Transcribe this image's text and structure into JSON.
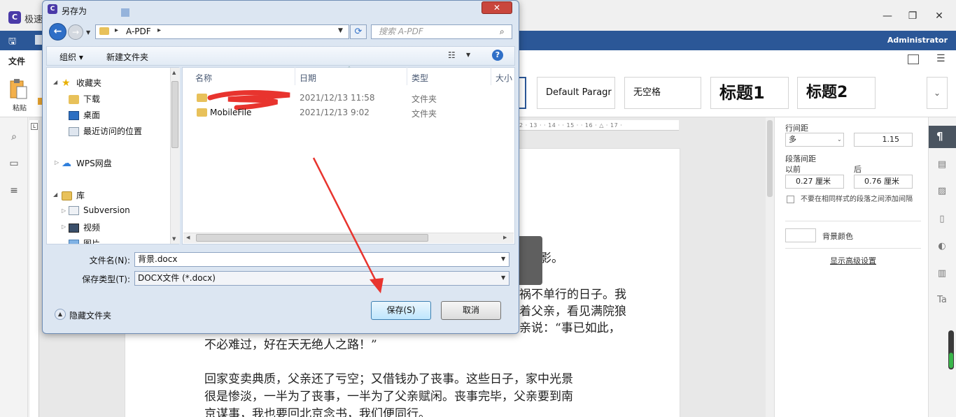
{
  "app": {
    "title": "极速",
    "user": "Administrator",
    "tab_file": "文件",
    "paste": "粘贴"
  },
  "styles": [
    "Default Paragr",
    "无空格",
    "标题1",
    "标题2"
  ],
  "ruler_text": "2 · 13 · · 14 · · 15 · · 16 · △ · 17 ·",
  "document": {
    "lines": [
      "的背影。",
      "祸不单行的日子。我",
      "着父亲，看见满院狼",
      "亲说：“事已如此，",
      "不必难过，好在天无绝人之路！”",
      "回家变卖典质，父亲还了亏空；又借钱办了丧事。这些日子，家中光景",
      "很是惨淡，一半为了丧事，一半为了父亲赋闲。丧事完毕，父亲要到南",
      "京谋事，我也要回北京念书，我们便同行。"
    ]
  },
  "panel": {
    "line_spacing_label": "行间距",
    "line_spacing_mode": "多",
    "line_spacing_value": "1.15",
    "para_spacing_label": "段落间距",
    "before_label": "以前",
    "after_label": "后",
    "before_value": "0.27 厘米",
    "after_value": "0.76 厘米",
    "no_space_checkbox": "不要在相同样式的段落之间添加间隔",
    "bg_color_label": "背景颜色",
    "advanced_link": "显示高级设置"
  },
  "dialog": {
    "title": "另存为",
    "address": "A-PDF",
    "search_placeholder": "搜索 A-PDF",
    "organize": "组织 ▾",
    "new_folder": "新建文件夹",
    "nav": {
      "favorites": "收藏夹",
      "downloads": "下载",
      "desktop": "桌面",
      "recent": "最近访问的位置",
      "wps_cloud": "WPS网盘",
      "libraries": "库",
      "subversion": "Subversion",
      "videos": "视频",
      "pictures": "图片"
    },
    "columns": {
      "name": "名称",
      "date": "日期",
      "type": "类型",
      "size": "大小"
    },
    "files": [
      {
        "name": "",
        "date": "2021/12/13 11:58",
        "type": "文件夹"
      },
      {
        "name": "MobileFile",
        "date": "2021/12/13 9:02",
        "type": "文件夹"
      }
    ],
    "filename_label": "文件名(N):",
    "filename_value": "背景.docx",
    "filetype_label": "保存类型(T):",
    "filetype_value": "DOCX文件 (*.docx)",
    "hide_folders": "隐藏文件夹",
    "save_button": "保存(S)",
    "cancel_button": "取消"
  },
  "colors": {
    "accent": "#2b5797",
    "annotation": "#e8342e"
  }
}
